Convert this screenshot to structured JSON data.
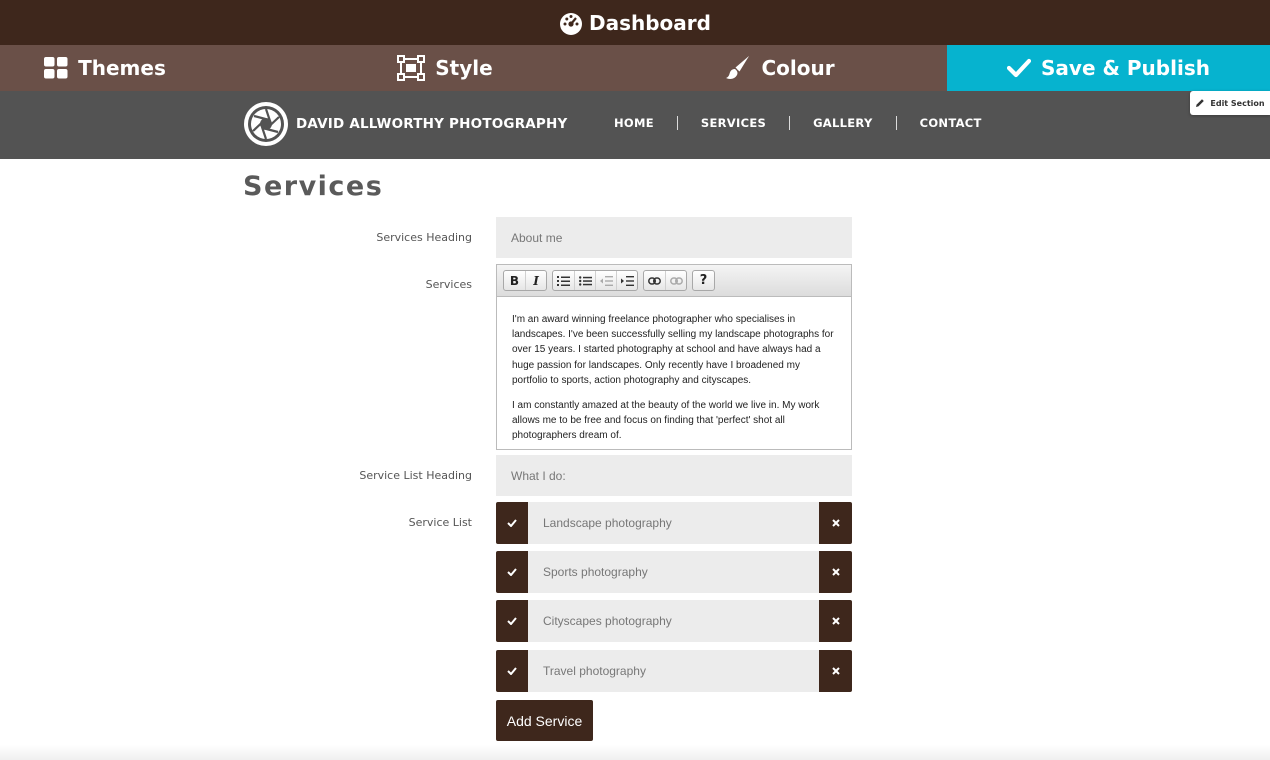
{
  "topbar": {
    "title": "Dashboard",
    "icon": "dashboard-gauge-icon"
  },
  "tabs": [
    {
      "label": "Themes",
      "icon": "grid-icon"
    },
    {
      "label": "Style",
      "icon": "frame-icon"
    },
    {
      "label": "Colour",
      "icon": "paintbrush-icon"
    },
    {
      "label": "Save & Publish",
      "icon": "checkmark-icon"
    }
  ],
  "colors": {
    "dark_brown": "#3e271c",
    "tab_brown": "#6a5048",
    "publish_cyan": "#06b3cf",
    "nav_grey": "#535353",
    "field_grey": "#ececec"
  },
  "site": {
    "brand": "DAVID ALLWORTHY PHOTOGRAPHY",
    "nav": [
      "HOME",
      "SERVICES",
      "GALLERY",
      "CONTACT"
    ]
  },
  "edit_section_label": "Edit Section",
  "page": {
    "title": "Services",
    "services_heading": {
      "label": "Services Heading",
      "value": "About me"
    },
    "services": {
      "label": "Services",
      "toolbar": [
        "bold",
        "italic",
        "numbered-list",
        "bullet-list",
        "outdent",
        "indent",
        "link",
        "unlink",
        "help"
      ],
      "paragraphs": [
        "I'm an award winning freelance photographer who specialises in landscapes. I've been successfully selling my landscape photographs for over 15 years. I started photography at school and have always had a huge passion for landscapes. Only recently have I broadened my portfolio to sports, action photography and cityscapes.",
        "I am constantly amazed at the beauty of the world we live in. My work allows me to be free and focus on finding that 'perfect' shot all photographers dream of."
      ]
    },
    "service_list_heading": {
      "label": "Service List Heading",
      "value": "What I do:"
    },
    "service_list": {
      "label": "Service List",
      "items": [
        "Landscape photography",
        "Sports photography",
        "Cityscapes photography",
        "Travel photography"
      ]
    },
    "add_service_label": "Add Service"
  }
}
